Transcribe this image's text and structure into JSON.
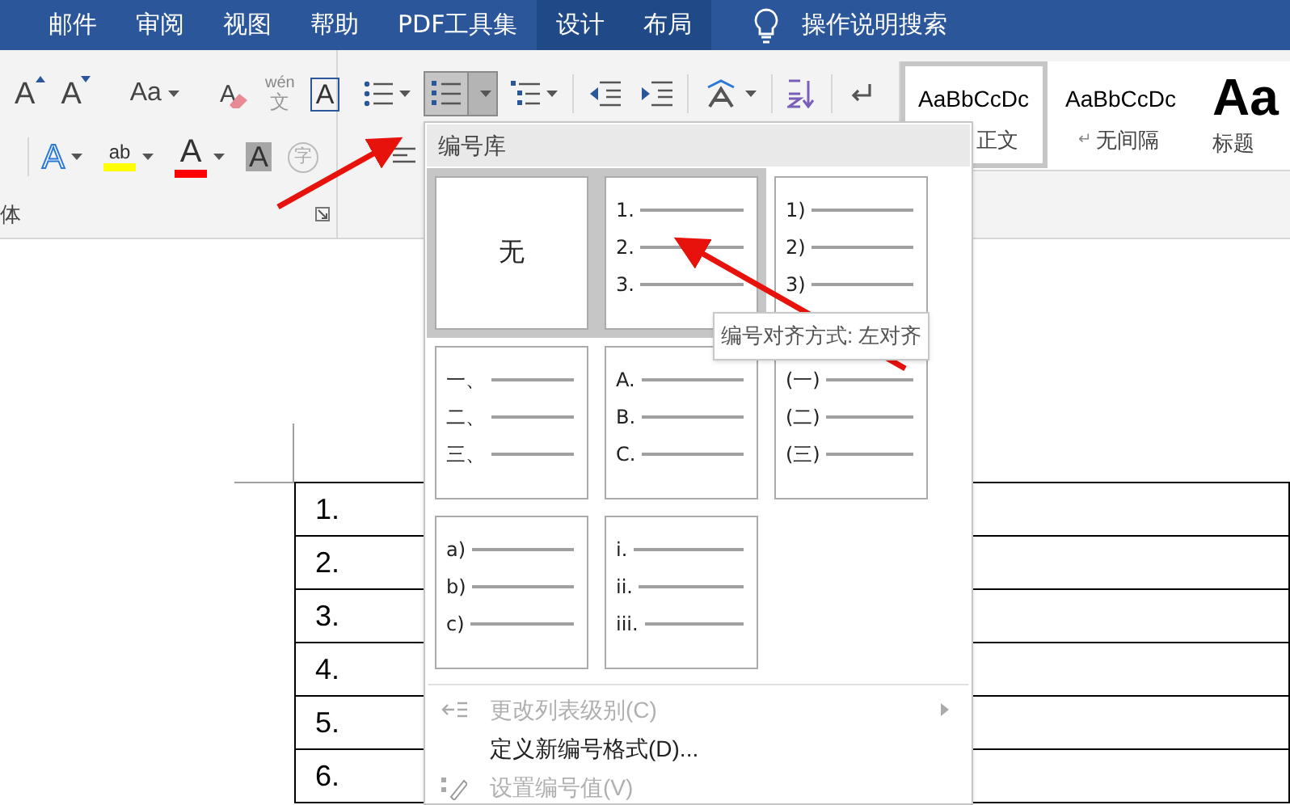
{
  "tabs": [
    {
      "label": "邮件",
      "contextual": false
    },
    {
      "label": "审阅",
      "contextual": false
    },
    {
      "label": "视图",
      "contextual": false
    },
    {
      "label": "帮助",
      "contextual": false
    },
    {
      "label": "PDF工具集",
      "contextual": false
    },
    {
      "label": "设计",
      "contextual": true
    },
    {
      "label": "布局",
      "contextual": true
    }
  ],
  "tell_me": {
    "placeholder": "操作说明搜索"
  },
  "font_group": {
    "label": "体",
    "row_1": [
      {
        "kind": "grow",
        "glyph": "A",
        "dropdown": false
      },
      {
        "kind": "shrink",
        "glyph": "A",
        "dropdown": false
      },
      {
        "kind": "case",
        "glyph": "Aa",
        "dropdown": true
      },
      {
        "kind": "clear",
        "glyph": "A",
        "dropdown": false
      },
      {
        "kind": "phonetic",
        "glyph": "文",
        "ruby": "wén",
        "dropdown": false
      },
      {
        "kind": "border",
        "glyph": "A",
        "dropdown": false
      }
    ],
    "row_2": [
      {
        "kind": "effects",
        "glyph": "A",
        "dropdown": true
      },
      {
        "kind": "highlight",
        "glyph": "ab",
        "dropdown": true,
        "color": "#ffff00"
      },
      {
        "kind": "fontcolor",
        "glyph": "A",
        "dropdown": true,
        "color": "#ff0000"
      },
      {
        "kind": "shading",
        "glyph": "A",
        "dropdown": false
      },
      {
        "kind": "enclose",
        "glyph": "字",
        "dropdown": false
      }
    ]
  },
  "paragraph_group": {
    "row_1": [
      {
        "kind": "bullets",
        "dropdown": true,
        "selected": false
      },
      {
        "kind": "numbering",
        "dropdown": true,
        "selected": true
      },
      {
        "kind": "multilevel",
        "dropdown": true,
        "selected": false
      },
      {
        "kind": "outdent",
        "dropdown": false,
        "selected": false
      },
      {
        "kind": "indent",
        "dropdown": false,
        "selected": false
      },
      {
        "kind": "asian",
        "dropdown": true,
        "selected": false
      },
      {
        "kind": "sort",
        "dropdown": false,
        "selected": false
      },
      {
        "kind": "marks",
        "dropdown": false,
        "selected": false
      }
    ]
  },
  "styles": [
    {
      "preview": "AaBbCcDc",
      "label": "正文",
      "selected": true
    },
    {
      "preview": "AaBbCcDc",
      "label": "无间隔",
      "mark": "↵",
      "selected": false
    },
    {
      "preview": "Aa",
      "label": "标题",
      "selected": false
    }
  ],
  "table": {
    "rows": [
      [
        "1."
      ],
      [
        "2."
      ],
      [
        "3."
      ],
      [
        "4."
      ],
      [
        "5."
      ],
      [
        "6."
      ]
    ]
  },
  "numbering_menu": {
    "title": "编号库",
    "items": [
      {
        "kind": "none",
        "label": "无",
        "selected": true
      },
      {
        "kind": "list",
        "markers": [
          "1.",
          "2.",
          "3."
        ],
        "selected": true
      },
      {
        "kind": "list",
        "markers": [
          "1)",
          "2)",
          "3)"
        ],
        "selected": false
      },
      {
        "kind": "list",
        "markers": [
          "一、",
          "二、",
          "三、"
        ],
        "selected": false
      },
      {
        "kind": "list",
        "markers": [
          "A.",
          "B.",
          "C."
        ],
        "selected": false
      },
      {
        "kind": "list",
        "markers": [
          "(一)",
          "(二)",
          "(三)"
        ],
        "selected": false
      },
      {
        "kind": "list",
        "markers": [
          "a)",
          "b)",
          "c)"
        ],
        "selected": false
      },
      {
        "kind": "list",
        "markers": [
          "i.",
          "ii.",
          "iii."
        ],
        "selected": false
      }
    ],
    "commands": [
      {
        "kind": "level",
        "label": "更改列表级别(C)",
        "disabled": true,
        "submenu": true
      },
      {
        "kind": "define",
        "label": "定义新编号格式(D)...",
        "disabled": false,
        "submenu": false
      },
      {
        "kind": "value",
        "label": "设置编号值(V)",
        "disabled": true,
        "submenu": false
      }
    ]
  },
  "tooltip": {
    "text": "编号对齐方式: 左对齐"
  }
}
